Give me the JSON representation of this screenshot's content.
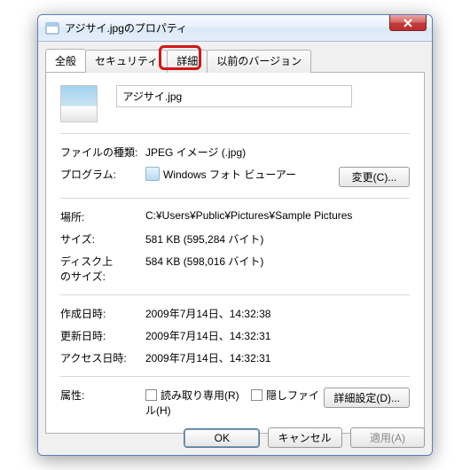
{
  "window": {
    "title": "アジサイ.jpgのプロパティ"
  },
  "tabs": {
    "general": "全般",
    "security": "セキュリティ",
    "details": "詳細",
    "previous": "以前のバージョン"
  },
  "file": {
    "name": "アジサイ.jpg"
  },
  "labels": {
    "filetype": "ファイルの種類:",
    "program": "プログラム:",
    "location": "場所:",
    "size": "サイズ:",
    "size_on_disk": "ディスク上\nのサイズ:",
    "created": "作成日時:",
    "modified": "更新日時:",
    "accessed": "アクセス日時:",
    "attributes": "属性:"
  },
  "values": {
    "filetype": "JPEG イメージ (.jpg)",
    "program": "Windows フォト ビューアー",
    "location": "C:¥Users¥Public¥Pictures¥Sample Pictures",
    "size": "581 KB (595,284 バイト)",
    "size_on_disk": "584 KB (598,016 バイト)",
    "created": "2009年7月14日、14:32:38",
    "modified": "2009年7月14日、14:32:31",
    "accessed": "2009年7月14日、14:32:31"
  },
  "attrs": {
    "readonly": "読み取り専用(R)",
    "hidden": "隠しファイル(H)"
  },
  "buttons": {
    "change": "変更(C)...",
    "advanced": "詳細設定(D)...",
    "ok": "OK",
    "cancel": "キャンセル",
    "apply": "適用(A)"
  }
}
